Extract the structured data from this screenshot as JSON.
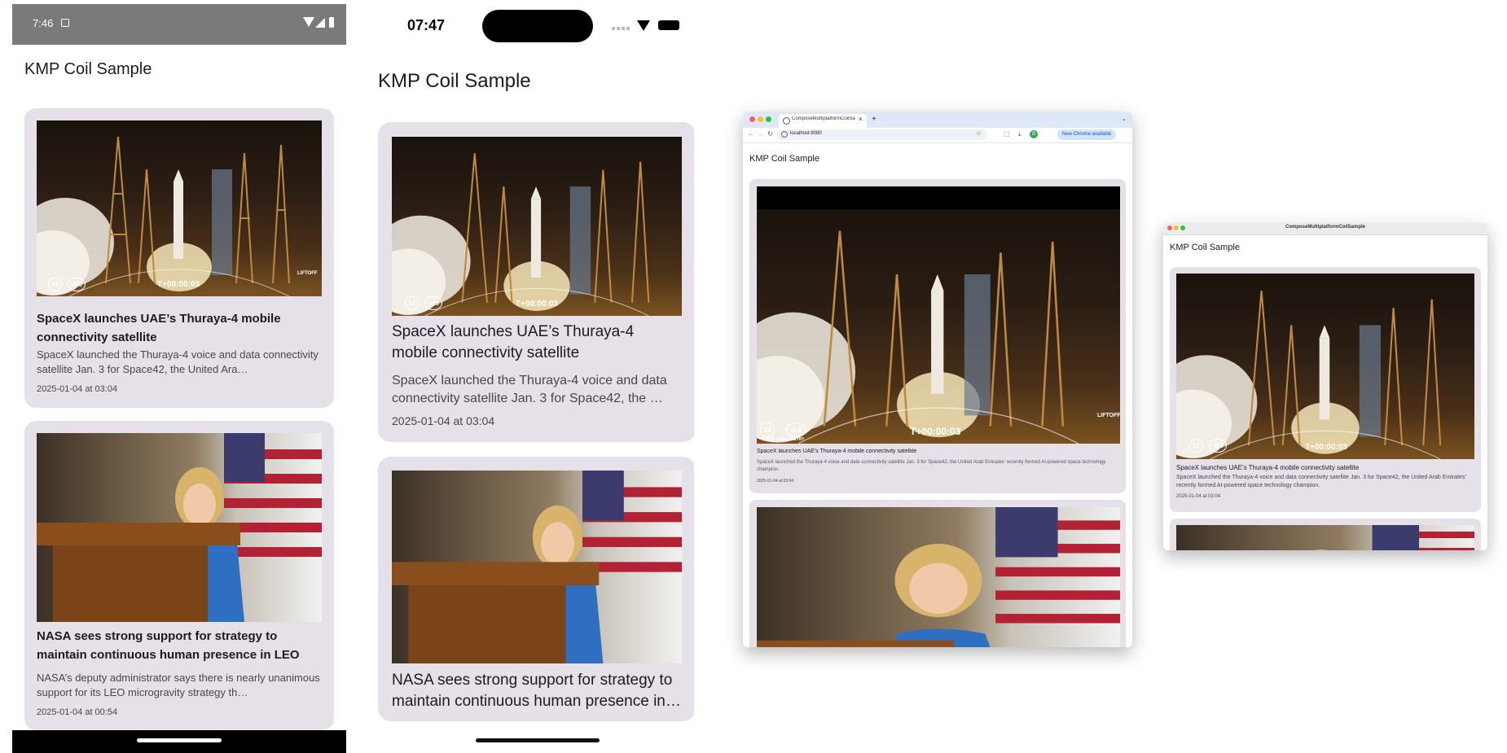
{
  "app_title": "KMP Coil Sample",
  "articles": [
    {
      "title": "SpaceX launches UAE’s Thuraya-4 mobile connectivity satellite",
      "summary": "SpaceX launched the Thuraya-4 voice and data connectivity satellite Jan. 3 for Space42, the United Arab Emirates’ recently formed AI-powered space technology champion.",
      "summary_truncated_android": "SpaceX launched the Thuraya-4 voice and data connectivity satellite Jan. 3 for Space42, the United Ara…",
      "summary_truncated_ios": "SpaceX launched the Thuraya-4 voice and data connectivity satellite Jan. 3 for Space42, the …",
      "date": "2025-01-04 at 03:04",
      "image": "rocket-launch-image",
      "overlay": {
        "timer": "T+00:00:03",
        "speed": "12",
        "altitude": "-0.0",
        "stage": "STAGE 1 TELEMETRY",
        "event": "LIFTOFF"
      }
    },
    {
      "title": "NASA sees strong support for strategy to maintain continuous human presence in LEO",
      "title_truncated_ios": "NASA sees strong support for strategy to maintain continuous human presence in…",
      "summary_truncated_android": "NASA’s deputy administrator says there is nearly unanimous support for its LEO microgravity strategy th…",
      "date": "2025-01-04 at 00:54",
      "image": "nasa-administrator-podium-image"
    }
  ],
  "android": {
    "time": "7:46",
    "status_icons": [
      "notification-icon",
      "wifi-icon",
      "signal-icon",
      "battery-icon"
    ]
  },
  "ios": {
    "time": "07:47",
    "status_icons": [
      "signal-dots-icon",
      "wifi-icon",
      "battery-icon"
    ]
  },
  "chrome": {
    "tab_title": "ComposeMultiplatformCoilSa",
    "new_tab": "+",
    "url": "localhost:8080",
    "update_badge": "New Chrome available",
    "profile_initial": "B"
  },
  "desktop": {
    "window_title": "ComposeMultiplatformCoilSample"
  },
  "colors": {
    "card_bg": "#e6e0e9",
    "android_status": "#7a7a7a",
    "chrome_tabbar": "#dfe8f7",
    "traffic_red": "#ff5f57",
    "traffic_yellow": "#febc2e",
    "traffic_green": "#28c840"
  }
}
